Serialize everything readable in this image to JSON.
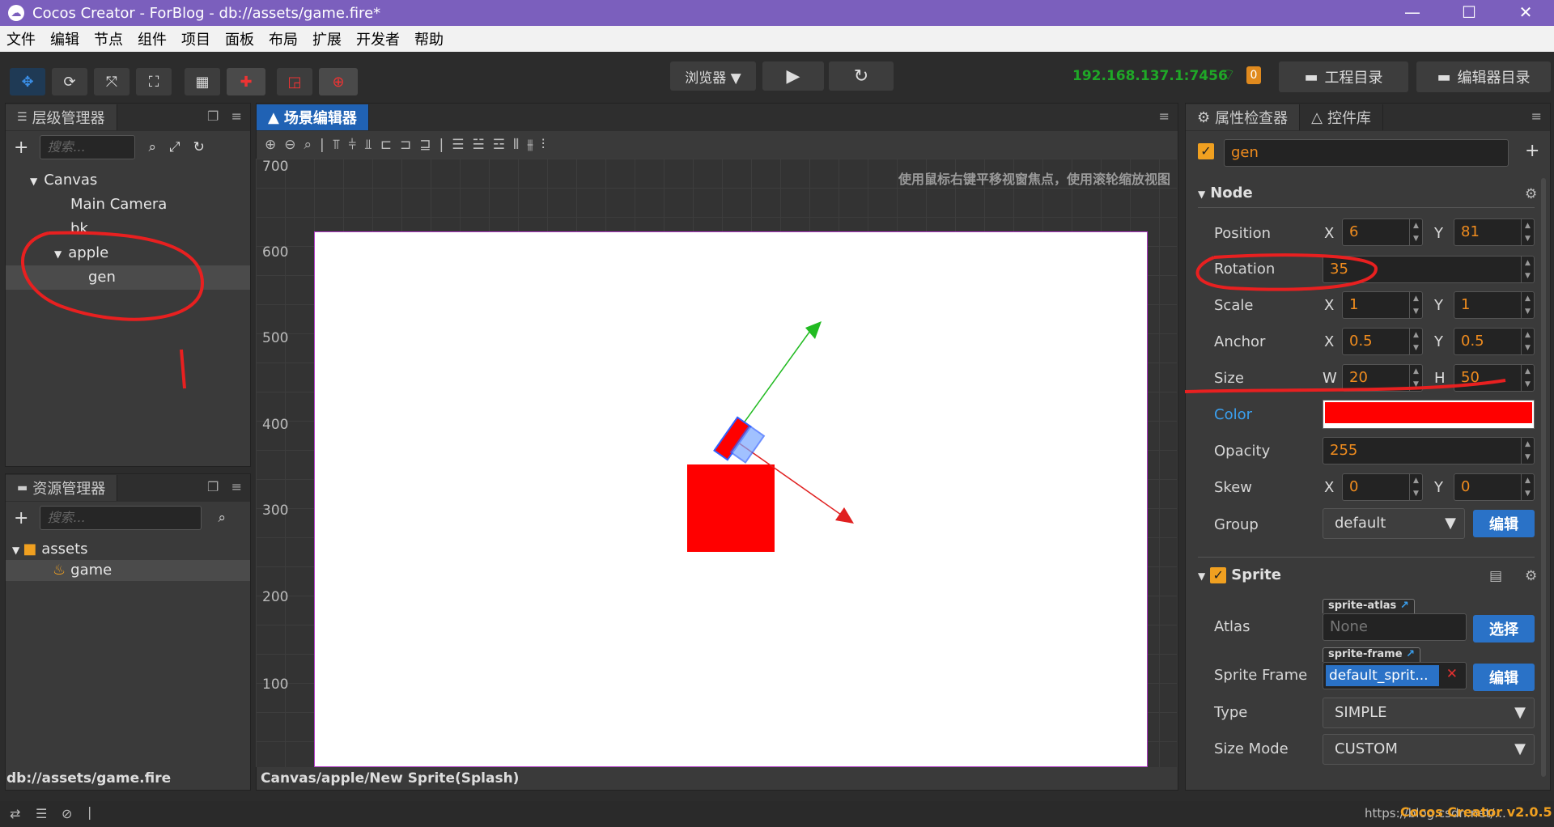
{
  "window": {
    "title": "Cocos Creator - ForBlog - db://assets/game.fire*",
    "app_glyph": "☁"
  },
  "menu": [
    "文件",
    "编辑",
    "节点",
    "组件",
    "项目",
    "面板",
    "布局",
    "扩展",
    "开发者",
    "帮助"
  ],
  "toolbar": {
    "preview_label": "浏览器 ▼",
    "ip": "192.168.137.1:7456",
    "badge": "0",
    "project_dir_label": "工程目录",
    "editor_dir_label": "编辑器目录"
  },
  "hierarchy": {
    "title": "层级管理器",
    "search_placeholder": "搜索...",
    "items": [
      {
        "label": "Canvas",
        "arrow": "▼"
      },
      {
        "label": "Main Camera"
      },
      {
        "label": "bk"
      },
      {
        "label": "apple",
        "arrow": "▼"
      },
      {
        "label": "gen"
      }
    ]
  },
  "assets": {
    "title": "资源管理器",
    "search_placeholder": "搜索...",
    "items": [
      {
        "label": "assets",
        "arrow": "▼"
      },
      {
        "label": "game"
      }
    ],
    "footer": "db://assets/game.fire"
  },
  "scene": {
    "tab": "场景编辑器",
    "hint": "使用鼠标右键平移视窗焦点，使用滚轮缩放视图",
    "y_labels": [
      "700",
      "600",
      "500",
      "400",
      "300",
      "200",
      "100"
    ],
    "footer": "Canvas/apple/New Sprite(Splash)"
  },
  "inspector": {
    "tab_props": "属性检查器",
    "tab_widgets": "控件库",
    "node_name": "gen",
    "node_section": "Node",
    "position": {
      "label": "Position",
      "x": "6",
      "y": "81"
    },
    "rotation": {
      "label": "Rotation",
      "value": "35"
    },
    "scale": {
      "label": "Scale",
      "x": "1",
      "y": "1"
    },
    "anchor": {
      "label": "Anchor",
      "x": "0.5",
      "y": "0.5"
    },
    "size": {
      "label": "Size",
      "w": "20",
      "h": "50"
    },
    "color": {
      "label": "Color",
      "value": "#ff0000"
    },
    "opacity": {
      "label": "Opacity",
      "value": "255"
    },
    "skew": {
      "label": "Skew",
      "x": "0",
      "y": "0"
    },
    "group": {
      "label": "Group",
      "value": "default",
      "edit": "编辑"
    },
    "sprite_section": "Sprite",
    "atlas": {
      "label": "Atlas",
      "tag": "sprite-atlas",
      "value": "None",
      "btn": "选择"
    },
    "sprite_frame": {
      "label": "Sprite Frame",
      "tag": "sprite-frame",
      "value": "default_sprit...",
      "btn": "编辑"
    },
    "type": {
      "label": "Type",
      "value": "SIMPLE"
    },
    "size_mode": {
      "label": "Size Mode",
      "value": "CUSTOM"
    },
    "axis_x": "X",
    "axis_y": "Y",
    "axis_w": "W",
    "axis_h": "H"
  },
  "status": {
    "right": "https://blog.csdn.net/...",
    "version": "Cocos Creator v2.0.5"
  }
}
